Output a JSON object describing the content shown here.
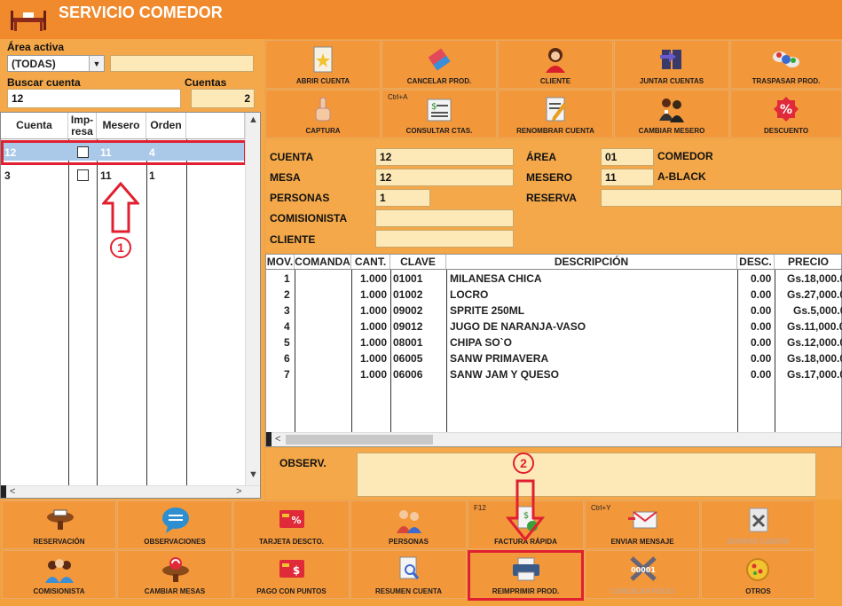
{
  "window": {
    "title": "SERVICIO COMEDOR"
  },
  "left": {
    "area_label": "Área activa",
    "area_value": "(TODAS)",
    "search_label": "Buscar cuenta",
    "search_value": "12",
    "count_label": "Cuentas",
    "count_value": "2",
    "columns": [
      "Cuenta",
      "Imp-resa",
      "Mesero",
      "Orden"
    ],
    "rows": [
      {
        "cuenta": "12",
        "mesero": "11",
        "orden": "4"
      },
      {
        "cuenta": "3",
        "mesero": "11",
        "orden": "1"
      }
    ]
  },
  "toolbar": {
    "abrir_cuenta": "ABRIR CUENTA",
    "cancelar_prod": "CANCELAR PROD.",
    "cliente": "CLIENTE",
    "juntar_cuentas": "JUNTAR CUENTAS",
    "traspasar_prod": "TRASPASAR PROD.",
    "captura": "CAPTURA",
    "consultar_ctas": "CONSULTAR CTAS.",
    "consultar_shortcut": "Ctrl+A",
    "renombrar_cuenta": "RENOMBRAR CUENTA",
    "cambiar_mesero": "CAMBIAR MESERO",
    "descuento": "DESCUENTO"
  },
  "info": {
    "cuenta_label": "CUENTA",
    "cuenta_value": "12",
    "mesa_label": "MESA",
    "mesa_value": "12",
    "personas_label": "PERSONAS",
    "personas_value": "1",
    "comisionista_label": "COMISIONISTA",
    "comisionista_value": "",
    "cliente_label": "CLIENTE",
    "cliente_value": "",
    "area_label": "ÁREA",
    "area_code": "01",
    "area_name": "COMEDOR",
    "mesero_label": "MESERO",
    "mesero_code": "11",
    "mesero_name": "A-BLACK",
    "reserva_label": "RESERVA",
    "reserva_value": ""
  },
  "products": {
    "columns": [
      "MOV.",
      "COMANDA",
      "CANT.",
      "CLAVE",
      "DESCRIPCIÓN",
      "DESC.",
      "PRECIO"
    ],
    "rows": [
      {
        "mov": "1",
        "cant": "1.000",
        "clave": "01001",
        "desc": "MILANESA CHICA",
        "dsc": "0.00",
        "precio": "Gs.18,000.0"
      },
      {
        "mov": "2",
        "cant": "1.000",
        "clave": "01002",
        "desc": "LOCRO",
        "dsc": "0.00",
        "precio": "Gs.27,000.0"
      },
      {
        "mov": "3",
        "cant": "1.000",
        "clave": "09002",
        "desc": "SPRITE 250ML",
        "dsc": "0.00",
        "precio": "Gs.5,000.0"
      },
      {
        "mov": "4",
        "cant": "1.000",
        "clave": "09012",
        "desc": "JUGO DE NARANJA-VASO",
        "dsc": "0.00",
        "precio": "Gs.11,000.0"
      },
      {
        "mov": "5",
        "cant": "1.000",
        "clave": "08001",
        "desc": "CHIPA SO`O",
        "dsc": "0.00",
        "precio": "Gs.12,000.0"
      },
      {
        "mov": "6",
        "cant": "1.000",
        "clave": "06005",
        "desc": "SANW PRIMAVERA",
        "dsc": "0.00",
        "precio": "Gs.18,000.0"
      },
      {
        "mov": "7",
        "cant": "1.000",
        "clave": "06006",
        "desc": "SANW JAM Y QUESO",
        "dsc": "0.00",
        "precio": "Gs.17,000.0"
      }
    ]
  },
  "observ_label": "OBSERV.",
  "bottom": {
    "reservacion": "RESERVACIÓN",
    "observaciones": "OBSERVACIONES",
    "tarjeta_descto": "TARJETA DESCTO.",
    "personas": "PERSONAS",
    "factura_rapida": "FACTURA RÁPIDA",
    "factura_shortcut": "F12",
    "enviar_mensaje": "ENVIAR MENSAJE",
    "enviar_shortcut": "Ctrl+Y",
    "borrar_cuenta": "BORRAR CUENTA",
    "comisionista": "COMISIONISTA",
    "cambiar_mesas": "CAMBIAR MESAS",
    "pago_con_puntos": "PAGO CON PUNTOS",
    "resumen_cuenta": "RESUMEN CUENTA",
    "reimprimir_prod": "REIMPRIMIR PROD.",
    "cancelar_folio": "CANCELAR FOLIO",
    "otros": "OTROS"
  },
  "annotations": {
    "one": "1",
    "two": "2"
  },
  "colors": {
    "accent_orange": "#f08a2c",
    "highlight_red": "#e02030",
    "selected_row": "#aac8e8"
  }
}
